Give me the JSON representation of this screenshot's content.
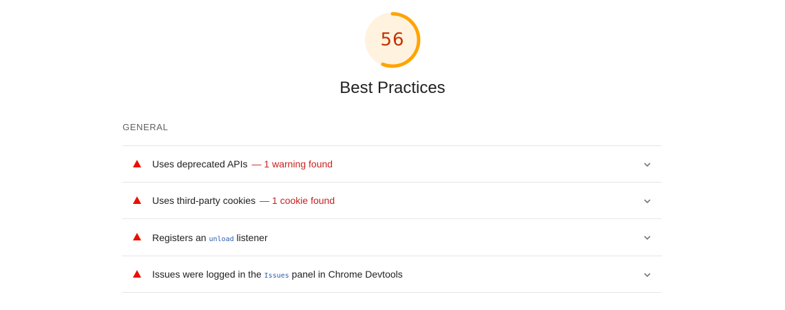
{
  "report": {
    "score": "56",
    "score_fraction": 0.56,
    "score_color": "#ffa400",
    "score_bg_color": "#fff3e0",
    "score_text_color": "#c33300",
    "title": "Best Practices"
  },
  "group": {
    "header": "GENERAL"
  },
  "audits": [
    {
      "title": "Uses deprecated APIs",
      "display": "— 1 warning found",
      "status": "fail",
      "icon": "triangle-warning-icon"
    },
    {
      "title": "Uses third-party cookies",
      "display": "— 1 cookie found",
      "status": "fail",
      "icon": "triangle-warning-icon"
    },
    {
      "title_before": "Registers an ",
      "code": "unload",
      "title_after": " listener",
      "status": "fail",
      "icon": "triangle-warning-icon"
    },
    {
      "title_before": "Issues were logged in the ",
      "code": "Issues",
      "title_after": " panel in Chrome Devtools",
      "status": "fail",
      "icon": "triangle-warning-icon"
    }
  ],
  "colors": {
    "fail": "#eb0f00",
    "fail_text": "#c7221f",
    "code": "#2a5db0",
    "divider": "#e6e6e6"
  }
}
